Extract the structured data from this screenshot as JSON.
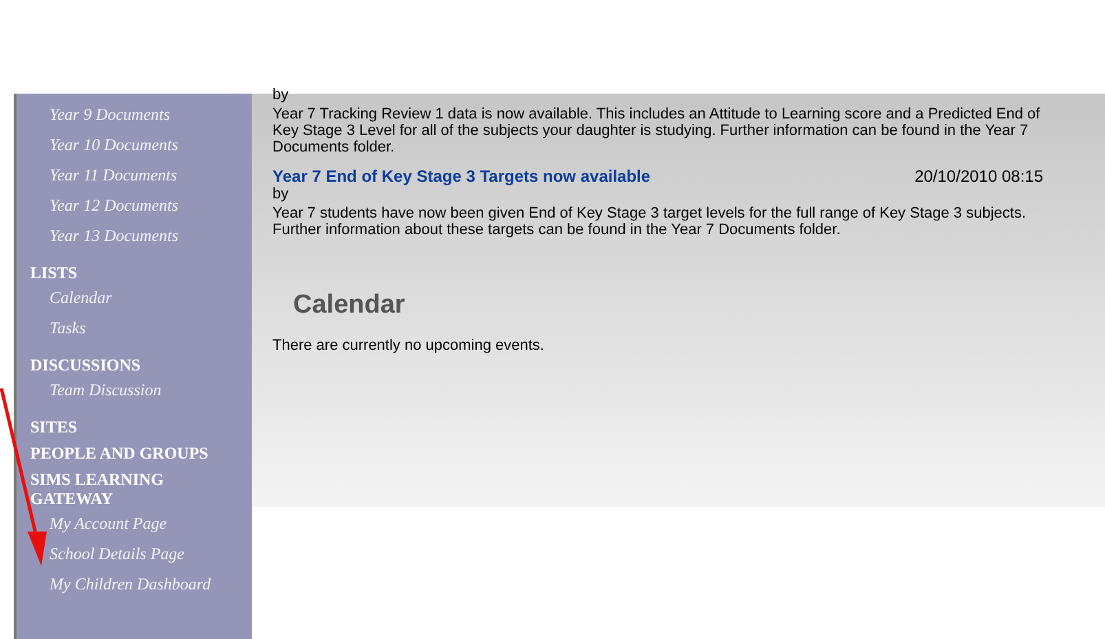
{
  "sidebar": {
    "sections": [
      {
        "items": [
          "Year 9 Documents",
          "Year 10 Documents",
          "Year 11 Documents",
          "Year 12 Documents",
          "Year 13 Documents"
        ]
      },
      {
        "heading": "LISTS",
        "items": [
          "Calendar",
          "Tasks"
        ]
      },
      {
        "heading": "DISCUSSIONS",
        "items": [
          "Team Discussion"
        ]
      },
      {
        "heading": "SITES"
      },
      {
        "heading": "PEOPLE AND GROUPS"
      },
      {
        "heading": "SIMS LEARNING GATEWAY",
        "items": [
          "My Account Page",
          "School Details Page",
          "My Children Dashboard"
        ]
      }
    ]
  },
  "announcements": [
    {
      "by": "by",
      "body": "Year 7 Tracking Review 1 data is now available. This includes an Attitude to Learning score and a Predicted End of Key Stage 3 Level for all of the subjects your daughter is studying. Further information can be found in the Year 7 Documents folder."
    },
    {
      "title": "Year 7 End of Key Stage 3 Targets now available",
      "date": "20/10/2010 08:15",
      "by": "by",
      "body": "Year 7 students have now been given End of Key Stage 3 target levels for the full range of Key Stage 3 subjects.  Further information about these targets can be found in the Year 7 Documents folder."
    }
  ],
  "calendar": {
    "heading": "Calendar",
    "message": "There are currently no upcoming events."
  }
}
